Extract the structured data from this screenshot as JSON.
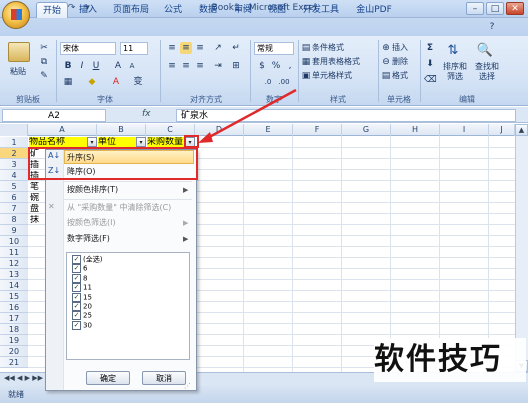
{
  "window": {
    "title": "Book1 - Microsoft Excel"
  },
  "qa_icons": [
    "save-icon",
    "undo-icon",
    "redo-icon",
    "customize-icon"
  ],
  "tabs": [
    {
      "label": "开始",
      "active": true
    },
    {
      "label": "插入"
    },
    {
      "label": "页面布局"
    },
    {
      "label": "公式"
    },
    {
      "label": "数据"
    },
    {
      "label": "审阅"
    },
    {
      "label": "视图"
    },
    {
      "label": "开发工具"
    },
    {
      "label": "金山PDF"
    }
  ],
  "ribbon": {
    "clipboard": {
      "paste": "粘贴",
      "label": "剪贴板"
    },
    "font": {
      "name": "宋体",
      "size": "11",
      "label": "字体",
      "bold": "B",
      "italic": "I",
      "underline": "U",
      "grow": "A",
      "shrink": "A",
      "font_color": "A",
      "phonetic": "变"
    },
    "alignment": {
      "label": "对齐方式"
    },
    "number": {
      "format": "常规",
      "label": "数字",
      "percent": "%",
      "comma": ","
    },
    "styles": {
      "conditional": "条件格式",
      "table": "套用表格格式",
      "cell": "单元格样式",
      "label": "样式"
    },
    "cells": {
      "insert": "插入",
      "delete": "删除",
      "format": "格式",
      "label": "单元格"
    },
    "editing": {
      "sum": "Σ",
      "sort": "排序和\n筛选",
      "find": "查找和\n选择",
      "label": "编辑"
    }
  },
  "formula_bar": {
    "name_box": "A2",
    "fx": "fx",
    "value": "矿泉水"
  },
  "columns": [
    "A",
    "B",
    "C",
    "D",
    "E",
    "F",
    "G",
    "H",
    "I",
    "J"
  ],
  "rows": [
    "1",
    "2",
    "3",
    "4",
    "5",
    "6",
    "7",
    "8",
    "9",
    "10",
    "11",
    "12",
    "13",
    "14",
    "15",
    "16",
    "17",
    "18",
    "19",
    "20",
    "21"
  ],
  "header_row": {
    "a": "物品名称",
    "b": "单位",
    "c": "采购数量"
  },
  "visible_cells": [
    "矿",
    "插",
    "插",
    "笔",
    "碗",
    "盘",
    "抹"
  ],
  "dropdown": {
    "sort_asc": "升序(S)",
    "sort_desc": "降序(O)",
    "sort_color": "按颜色排序(T)",
    "clear_filter": "从 \"采购数量\" 中清除筛选(C)",
    "filter_color": "按颜色筛选(I)",
    "number_filter": "数字筛选(F)",
    "checklist": [
      "(全选)",
      "6",
      "8",
      "11",
      "15",
      "20",
      "25",
      "30"
    ],
    "ok": "确定",
    "cancel": "取消"
  },
  "sheet_tabs": {
    "nav": "◀◀ ◀ ▶ ▶▶"
  },
  "status": {
    "ready": "就绪"
  },
  "watermark": "软件技巧",
  "colors": {
    "accent": "#e0292b",
    "header_fill": "#ffff00"
  }
}
